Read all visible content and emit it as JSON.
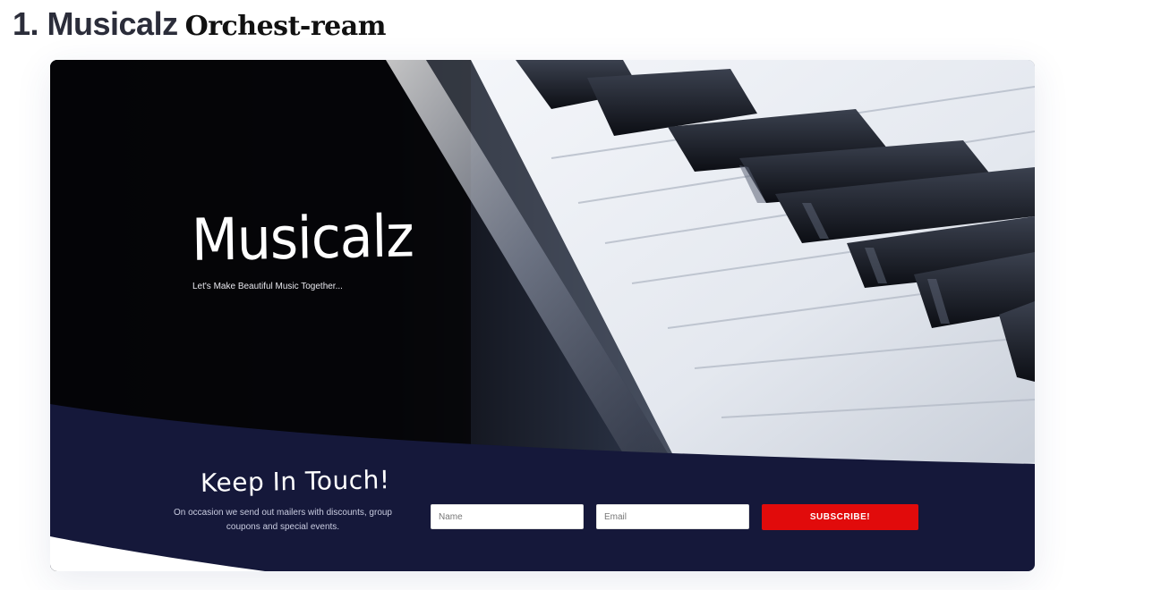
{
  "heading": {
    "main": "1. Musicalz",
    "sub": "Orchest-ream"
  },
  "hero": {
    "logo": "Musicalz",
    "tagline": "Let's Make Beautiful Music Together..."
  },
  "newsletter": {
    "heading": "Keep In Touch!",
    "text": "On occasion we send out mailers with discounts, group coupons and special events.",
    "name_placeholder": "Name",
    "email_placeholder": "Email",
    "subscribe_label": "SUBSCRIBE!"
  },
  "colors": {
    "navy": "#15183a",
    "accent_red": "#e10b0b",
    "heading_text": "#2b2d3a"
  }
}
